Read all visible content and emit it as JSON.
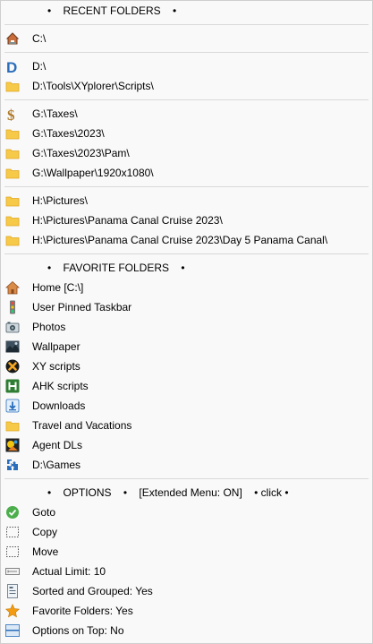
{
  "recent_folders": {
    "header": "•    RECENT FOLDERS    •",
    "groups": [
      [
        {
          "label": "C:\\",
          "icon": "home-drive-icon"
        }
      ],
      [
        {
          "label": "D:\\",
          "icon": "d-drive-icon"
        },
        {
          "label": "D:\\Tools\\XYplorer\\Scripts\\",
          "icon": "folder-icon"
        }
      ],
      [
        {
          "label": "G:\\Taxes\\",
          "icon": "dollar-folder-icon"
        },
        {
          "label": "G:\\Taxes\\2023\\",
          "icon": "folder-icon"
        },
        {
          "label": "G:\\Taxes\\2023\\Pam\\",
          "icon": "folder-icon"
        },
        {
          "label": "G:\\Wallpaper\\1920x1080\\",
          "icon": "folder-icon"
        }
      ],
      [
        {
          "label": "H:\\Pictures\\",
          "icon": "folder-icon"
        },
        {
          "label": "H:\\Pictures\\Panama Canal Cruise 2023\\",
          "icon": "folder-icon"
        },
        {
          "label": "H:\\Pictures\\Panama Canal Cruise 2023\\Day 5 Panama Canal\\",
          "icon": "folder-icon"
        }
      ]
    ]
  },
  "favorite_folders": {
    "header": "•    FAVORITE FOLDERS    •",
    "items": [
      {
        "label": "Home [C:\\]",
        "icon": "home-icon"
      },
      {
        "label": "User Pinned Taskbar",
        "icon": "traffic-light-icon"
      },
      {
        "label": "Photos",
        "icon": "camera-icon"
      },
      {
        "label": "Wallpaper",
        "icon": "landscape-icon"
      },
      {
        "label": "XY scripts",
        "icon": "xy-icon"
      },
      {
        "label": "AHK scripts",
        "icon": "ahk-icon"
      },
      {
        "label": "Downloads",
        "icon": "download-icon"
      },
      {
        "label": "Travel and Vacations",
        "icon": "folder-icon"
      },
      {
        "label": "Agent DLs",
        "icon": "agent-icon"
      },
      {
        "label": "D:\\Games",
        "icon": "puzzle-icon"
      }
    ]
  },
  "options": {
    "header": "•    OPTIONS    •    [Extended Menu: ON]    • click •",
    "items": [
      {
        "label": "Goto",
        "icon": "check-icon"
      },
      {
        "label": "Copy",
        "icon": "dotted-box-icon"
      },
      {
        "label": "Move",
        "icon": "dotted-box-icon"
      },
      {
        "label": "Actual Limit: 10",
        "icon": "limit-icon"
      },
      {
        "label": "Sorted and Grouped: Yes",
        "icon": "sorted-icon"
      },
      {
        "label": "Favorite Folders: Yes",
        "icon": "star-icon"
      },
      {
        "label": "Options on Top: No",
        "icon": "layout-icon"
      }
    ]
  },
  "colors": {
    "folder": "#f7c948",
    "folder_dark": "#e0a820",
    "check_green": "#4cae4c",
    "drive_blue": "#2a6ebb",
    "star": "#f39c12"
  }
}
